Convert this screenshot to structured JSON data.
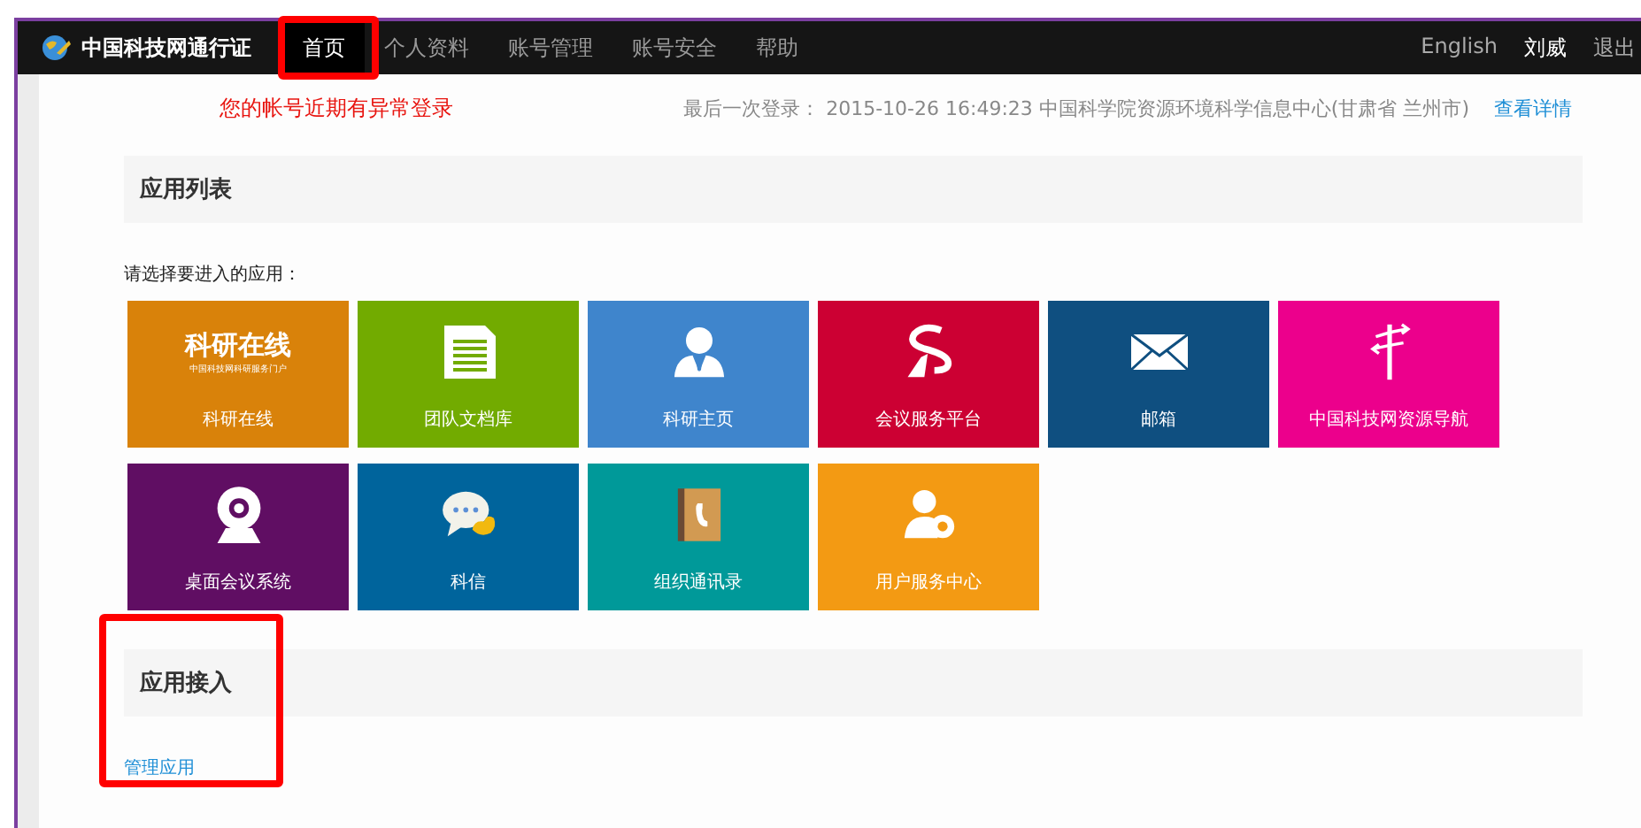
{
  "brand": {
    "title": "中国科技网通行证"
  },
  "nav": [
    {
      "label": "首页",
      "selected": true,
      "highlighted": true
    },
    {
      "label": "个人资料",
      "selected": false,
      "highlighted": false
    },
    {
      "label": "账号管理",
      "selected": false,
      "highlighted": false
    },
    {
      "label": "账号安全",
      "selected": false,
      "highlighted": false
    },
    {
      "label": "帮助",
      "selected": false,
      "highlighted": false
    }
  ],
  "user_menu": [
    "English",
    "刘威",
    "退出"
  ],
  "alert": {
    "warning": "您的帐号近期有异常登录",
    "last_login": "最后一次登录：  2015-10-26 16:49:23 中国科学院资源环境科学信息中心(甘肃省 兰州市)",
    "link": "查看详情"
  },
  "sections": [
    {
      "title": "应用列表",
      "highlighted": false,
      "prompt": "请选择要进入的应用：",
      "apps": [
        {
          "label": "科研在线",
          "kind": "logo",
          "color": "#d9820a",
          "logo_title": "科研在线",
          "logo_subtitle": "中国科技网科研服务门户"
        },
        {
          "label": "团队文档库",
          "kind": "document",
          "color": "#72ab00"
        },
        {
          "label": "科研主页",
          "kind": "person",
          "color": "#3f85cc"
        },
        {
          "label": "会议服务平台",
          "kind": "meeting",
          "color": "#cc0033"
        },
        {
          "label": "邮箱",
          "kind": "mail",
          "color": "#0f4f80"
        },
        {
          "label": "中国科技网资源导航",
          "kind": "signpost",
          "color": "#ec008c"
        },
        {
          "label": "桌面会议系统",
          "kind": "webcam",
          "color": "#600e63"
        },
        {
          "label": "科信",
          "kind": "chat",
          "color": "#00649c"
        },
        {
          "label": "组织通讯录",
          "kind": "addressbook",
          "color": "#009999"
        },
        {
          "label": "用户服务中心",
          "kind": "usergear",
          "color": "#f39a13"
        }
      ]
    },
    {
      "title": "应用接入",
      "highlighted": true,
      "link": "管理应用"
    }
  ]
}
